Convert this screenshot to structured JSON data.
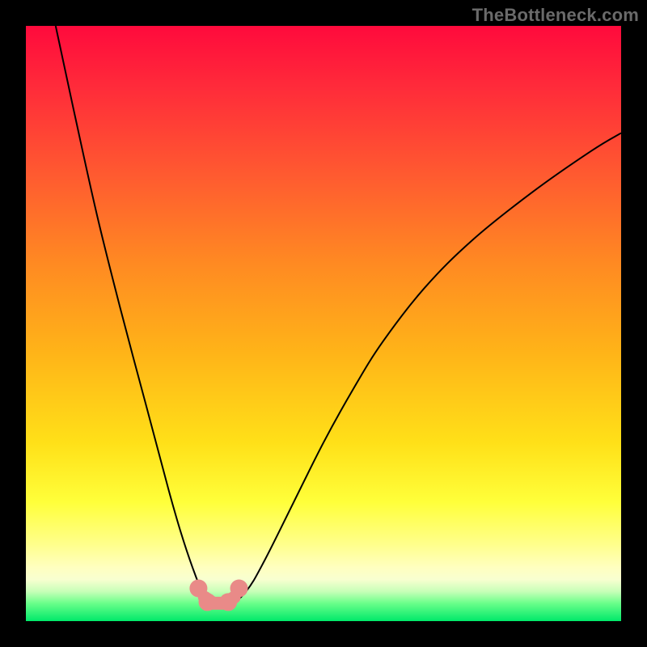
{
  "watermark": "TheBottleneck.com",
  "chart_data": {
    "type": "line",
    "title": "",
    "xlabel": "",
    "ylabel": "",
    "xlim": [
      0,
      100
    ],
    "ylim": [
      0,
      100
    ],
    "grid": false,
    "series": [
      {
        "name": "curve",
        "x": [
          5,
          8,
          12,
          16,
          20,
          24,
          26,
          28,
          30,
          31.5,
          34,
          37,
          40,
          45,
          50,
          55,
          60,
          67,
          75,
          85,
          95,
          100
        ],
        "y": [
          100,
          86,
          68,
          52,
          37,
          22,
          15,
          9,
          4,
          2.5,
          2.5,
          5,
          10,
          20,
          30,
          39,
          47,
          56,
          64,
          72,
          79,
          82
        ]
      }
    ],
    "markers": [
      {
        "x": 29.0,
        "y": 5.5
      },
      {
        "x": 30.5,
        "y": 3.2
      },
      {
        "x": 34.0,
        "y": 3.2
      },
      {
        "x": 35.8,
        "y": 5.5
      }
    ],
    "marker_connector": [
      {
        "x": 30.0,
        "y": 4.0
      },
      {
        "x": 31.5,
        "y": 3.0
      },
      {
        "x": 33.5,
        "y": 3.0
      },
      {
        "x": 35.0,
        "y": 4.0
      }
    ]
  }
}
